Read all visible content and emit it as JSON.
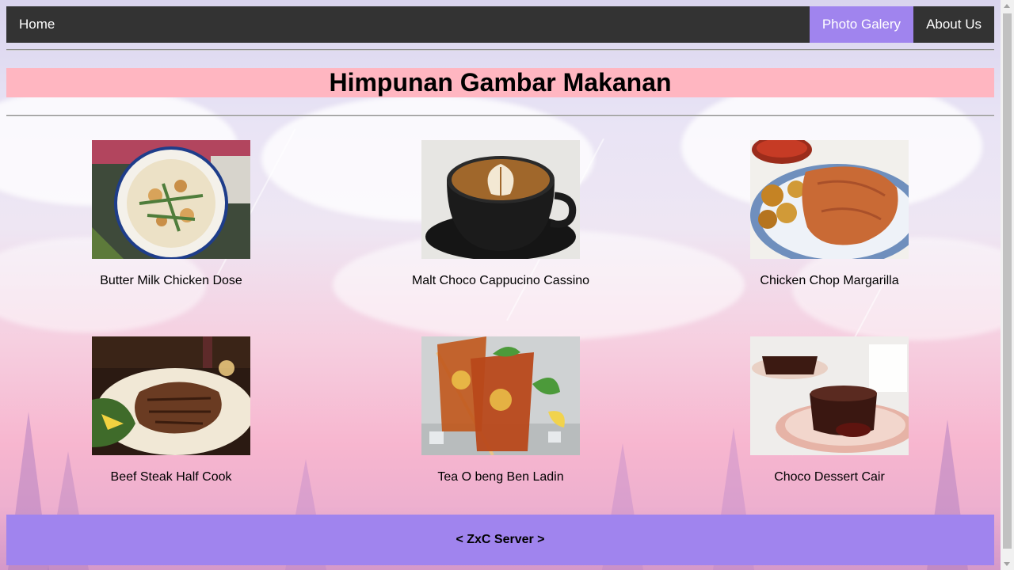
{
  "nav": {
    "home": "Home",
    "gallery": "Photo Galery",
    "about": "About Us"
  },
  "title": "Himpunan Gambar Makanan",
  "gallery": [
    {
      "caption": "Butter Milk Chicken Dose"
    },
    {
      "caption": "Malt Choco Cappucino Cassino"
    },
    {
      "caption": "Chicken Chop Margarilla"
    },
    {
      "caption": "Beef Steak Half Cook"
    },
    {
      "caption": "Tea O beng Ben Ladin"
    },
    {
      "caption": "Choco Dessert Cair"
    }
  ],
  "footer": "< ZxC Server >",
  "colors": {
    "navbar": "#333333",
    "nav_active": "#a084ee",
    "title_band": "#ffb6c1",
    "footer": "#a084ee"
  }
}
